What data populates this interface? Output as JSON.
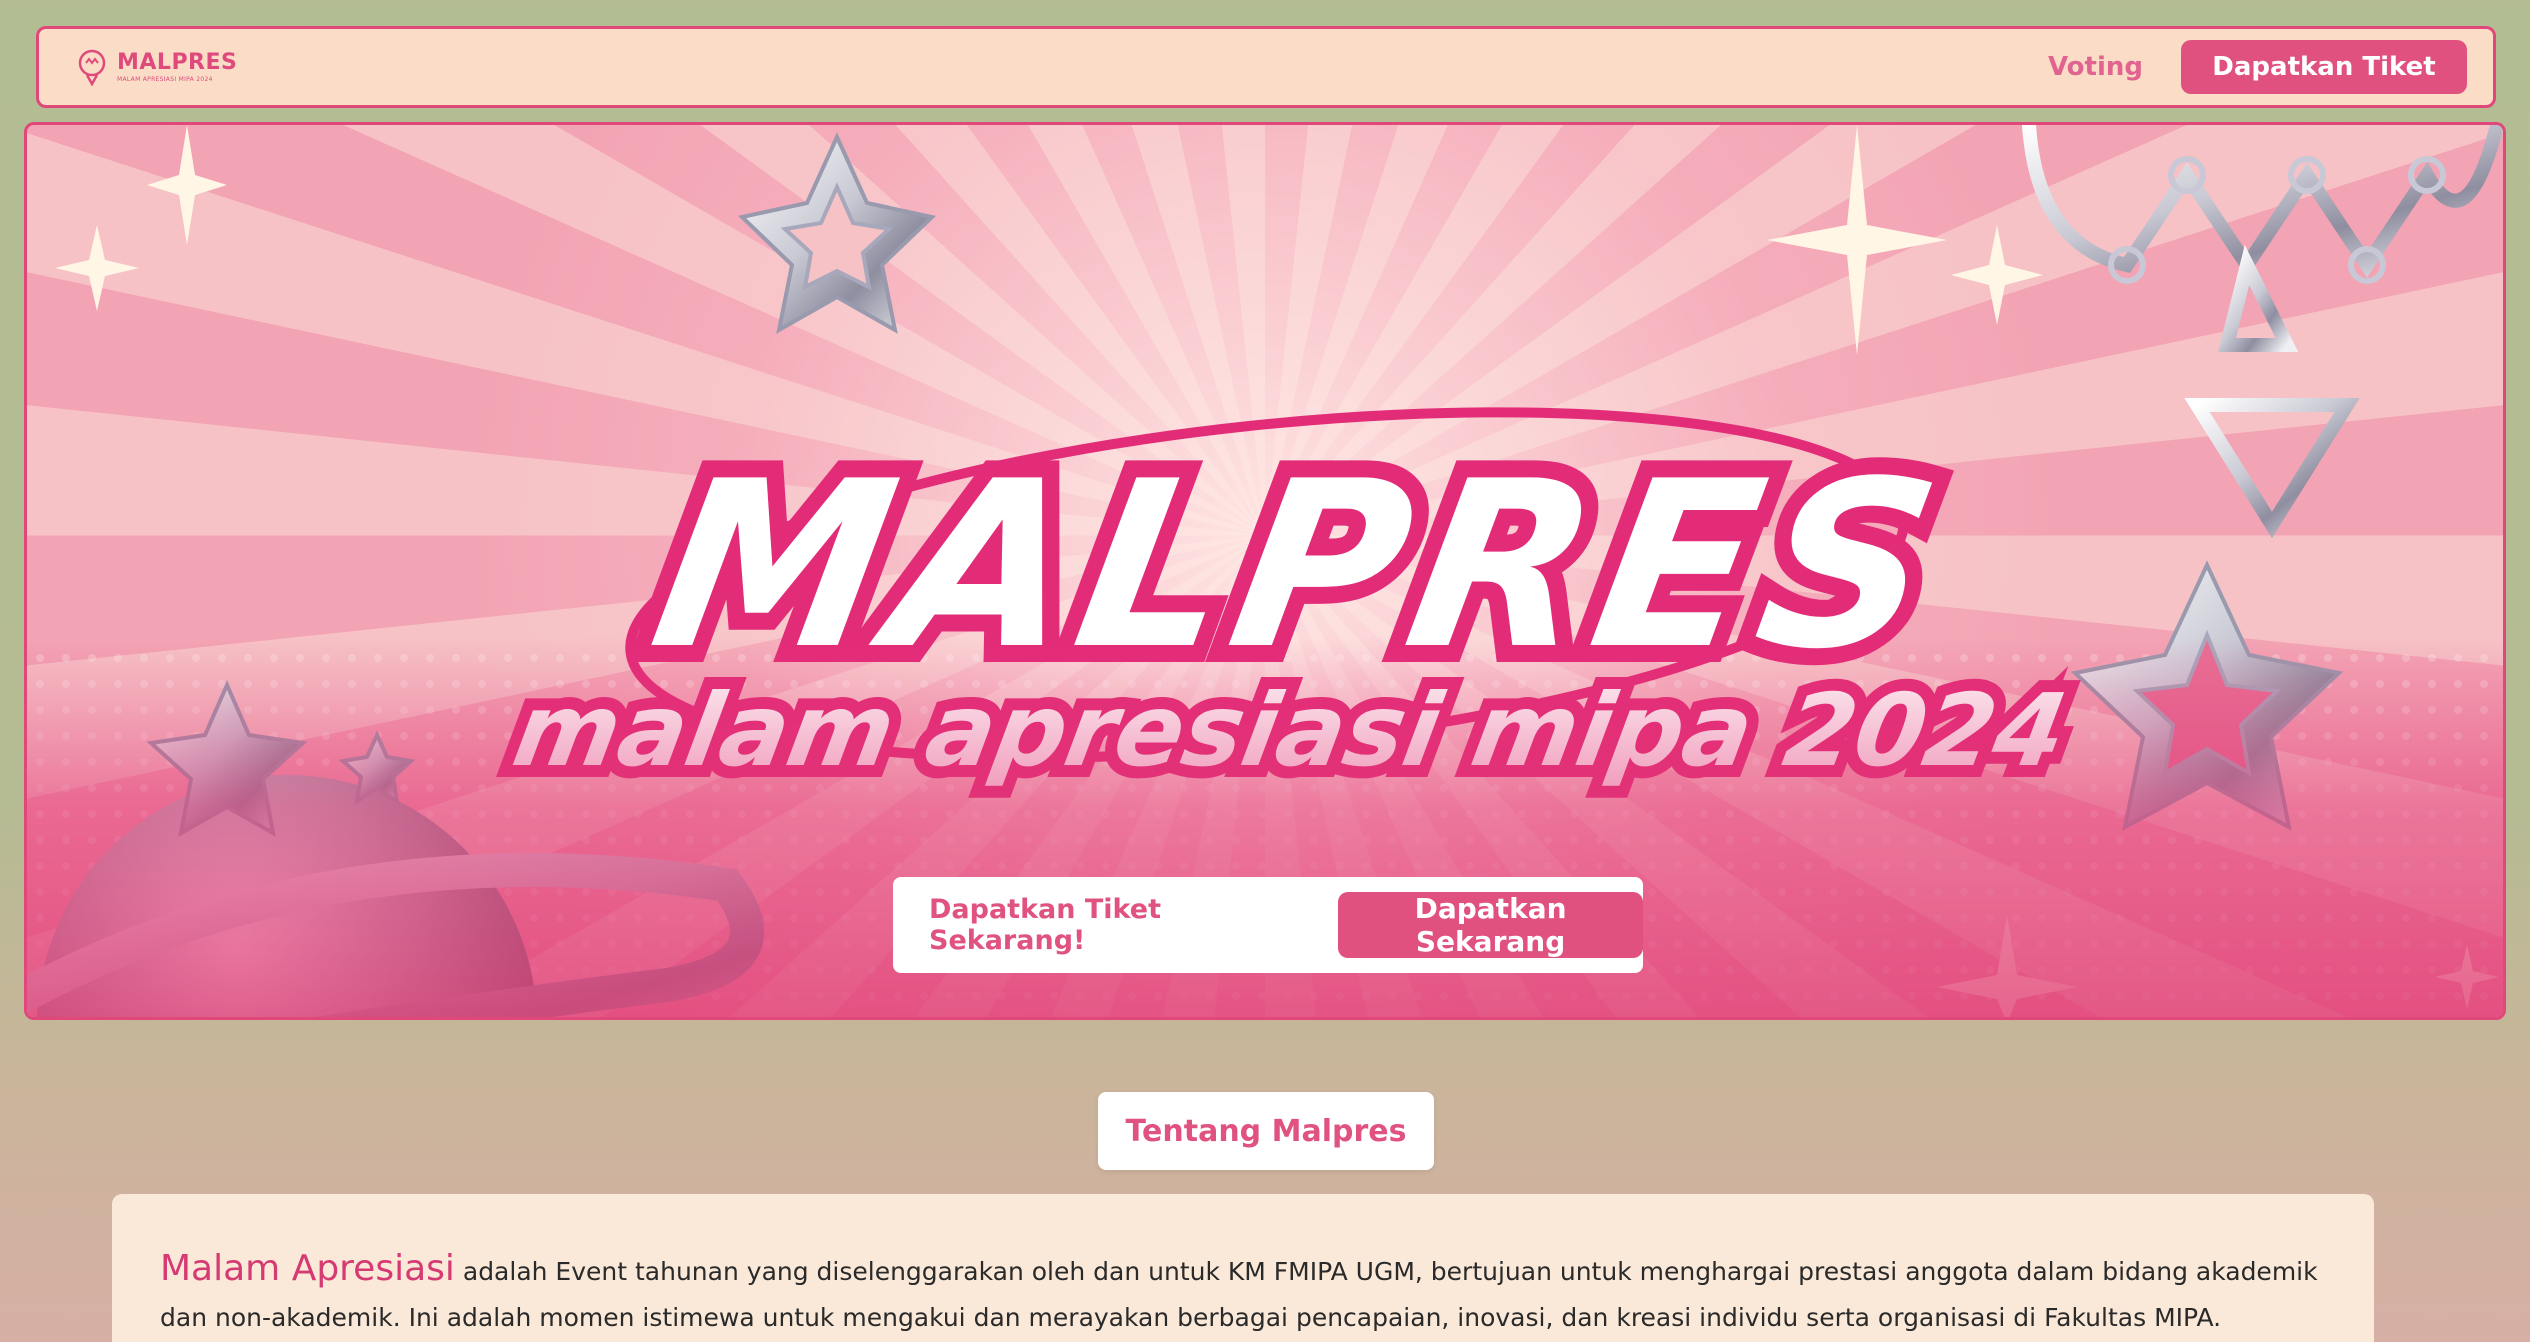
{
  "navbar": {
    "logo_title": "MALPRES",
    "logo_sub": "MALAM APRESIASI MIPA 2024",
    "voting_label": "Voting",
    "cta_label": "Dapatkan Tiket"
  },
  "hero": {
    "title": "MALPRES",
    "subtitle": "malam apresiasi mipa 2024",
    "cta_label": "Dapatkan Tiket Sekarang!",
    "cta_button": "Dapatkan Sekarang"
  },
  "about": {
    "pill_label": "Tentang Malpres",
    "highlight": "Malam Apresiasi",
    "body": " adalah Event tahunan yang diselenggarakan oleh dan untuk KM FMIPA UGM, bertujuan untuk menghargai prestasi anggota dalam bidang akademik dan non-akademik. Ini adalah momen istimewa untuk mengakui dan merayakan berbagai pencapaian, inovasi, dan kreasi individu serta organisasi di Fakultas MIPA."
  },
  "colors": {
    "brand_pink": "#e0517f",
    "nav_bg": "#fbdcc7",
    "page_bg": "#b3bd93",
    "card_bg": "#fae9d8"
  }
}
